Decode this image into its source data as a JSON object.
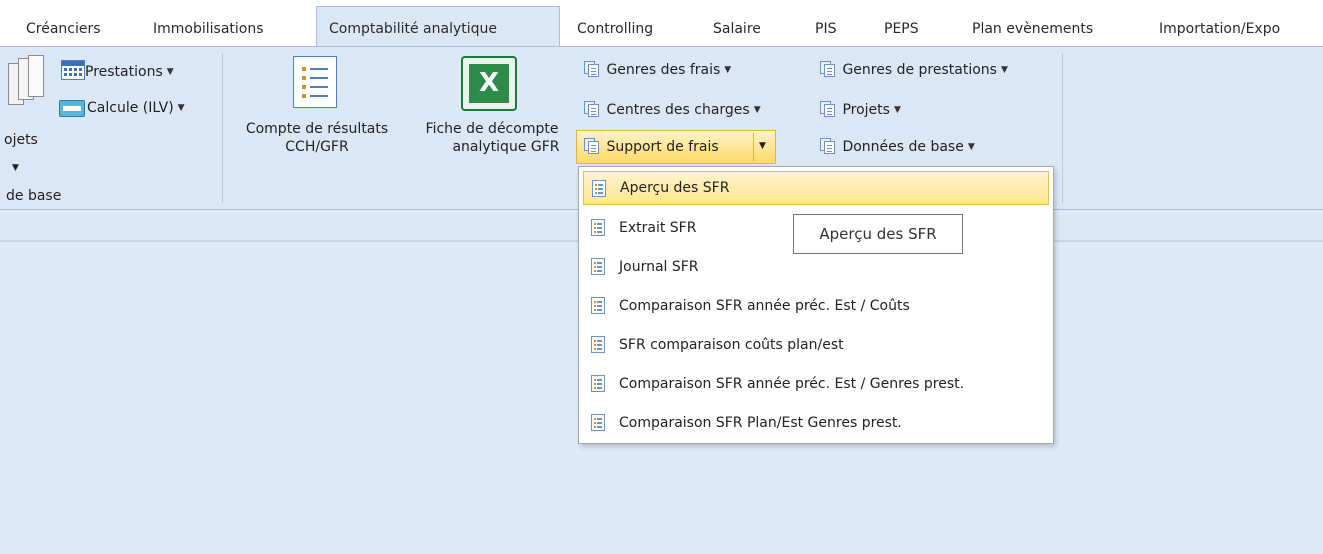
{
  "tabs": [
    {
      "label": "Créanciers"
    },
    {
      "label": "Immobilisations"
    },
    {
      "label": "Comptabilité analytique",
      "active": true
    },
    {
      "label": "Controlling"
    },
    {
      "label": "Salaire"
    },
    {
      "label": "PIS"
    },
    {
      "label": "PEPS"
    },
    {
      "label": "Plan evènements"
    },
    {
      "label": "Importation/Expo"
    }
  ],
  "ribbon": {
    "left_group": {
      "projets_label": "ojets",
      "prestations_label": "Prestations",
      "calcule_label": "Calcule (ILV)",
      "group_title": "de base"
    },
    "compte_resultats": {
      "line1": "Compte de résultats",
      "line2": "CCH/GFR"
    },
    "fiche_decompte": {
      "line1": "Fiche de décompte",
      "line2": "analytique GFR"
    },
    "genres_frais": "Genres des frais",
    "centres_charges": "Centres des charges",
    "support_frais": "Support de frais",
    "genres_prestations": "Genres de prestations",
    "projets": "Projets",
    "donnees_base": "Données de base"
  },
  "menu": {
    "items": [
      {
        "label": "Aperçu des SFR",
        "highlighted": true
      },
      {
        "label": "Extrait SFR"
      },
      {
        "label": "Journal SFR"
      },
      {
        "label": "Comparaison SFR année préc. Est  / Coûts"
      },
      {
        "label": "SFR comparaison coûts plan/est"
      },
      {
        "label": "Comparaison SFR année préc. Est  / Genres prest."
      },
      {
        "label": "Comparaison SFR Plan/Est Genres prest."
      }
    ]
  },
  "tooltip": "Aperçu des SFR",
  "colors": {
    "highlight": "#ffe58c",
    "ribbon_bg": "#dce7f6",
    "content_bg": "#dfeaf8",
    "excel_green": "#1e7a3a"
  }
}
